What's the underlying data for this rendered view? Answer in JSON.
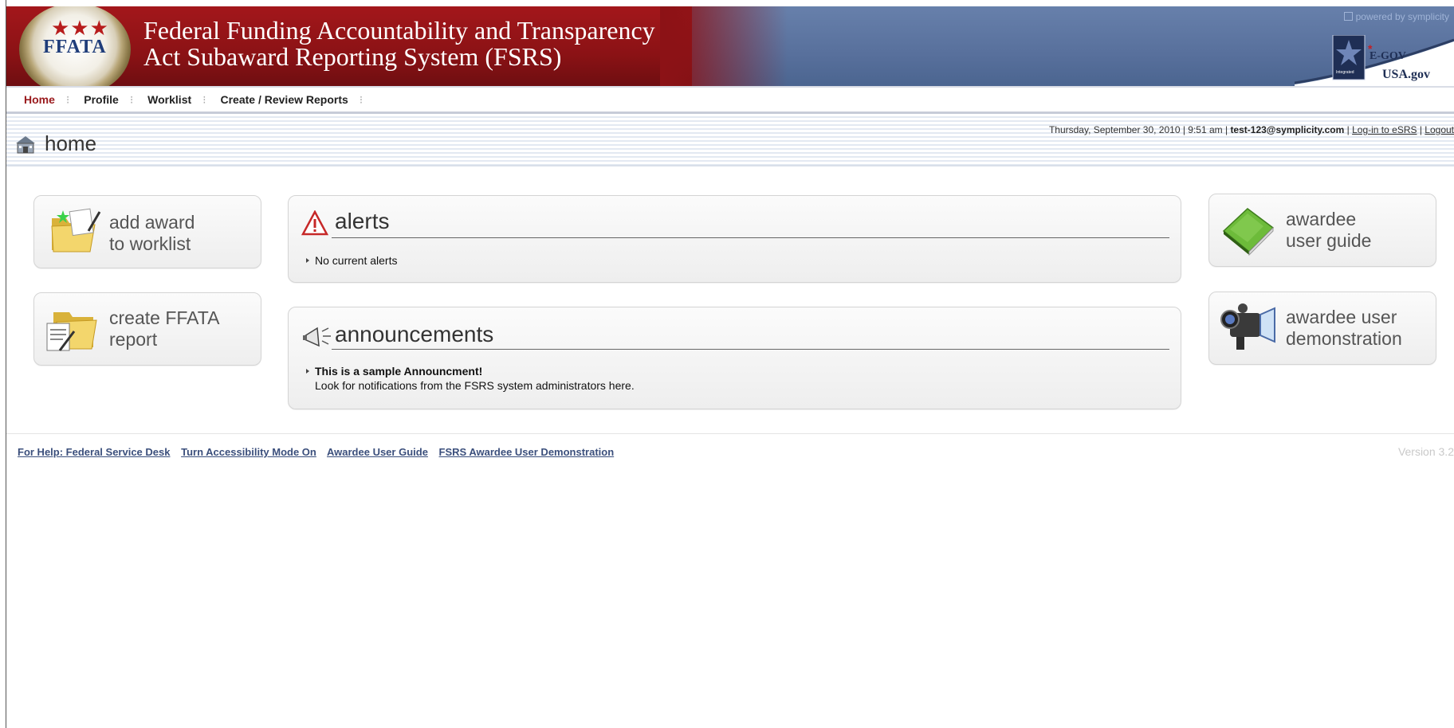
{
  "header": {
    "title_line1": "Federal Funding Accountability and Transparency",
    "title_line2": "Act Subaward Reporting System (FSRS)",
    "seal_text": "FFATA",
    "powered_by": "powered by symplicity",
    "egov_label": "E-GOV",
    "usagov_label": "USA.gov"
  },
  "nav": {
    "items": [
      "Home",
      "Profile",
      "Worklist",
      "Create / Review Reports"
    ],
    "active": "Home"
  },
  "subheader": {
    "page_title": "home",
    "datetime": "Thursday, September 30, 2010 | 9:51 am |",
    "user": "test-123@symplicity.com",
    "login_esrs": "Log-in to eSRS",
    "logout": "Logout"
  },
  "tiles": {
    "add_award_line1": "add award",
    "add_award_line2": "to worklist",
    "create_report_line1": "create FFATA",
    "create_report_line2": "report",
    "guide_line1": "awardee",
    "guide_line2": "user guide",
    "demo_line1": "awardee user",
    "demo_line2": "demonstration"
  },
  "alerts": {
    "title": "alerts",
    "message": "No current alerts"
  },
  "announcements": {
    "title": "announcements",
    "headline": "This is a sample Announcment!",
    "body": "Look for notifications from the FSRS system administrators here."
  },
  "footer": {
    "links": [
      "For Help: Federal Service Desk",
      "Turn Accessibility Mode On",
      "Awardee User Guide",
      "FSRS Awardee User Demonstration"
    ],
    "version": "Version 3.2"
  },
  "colors": {
    "header_red": "#8b1215",
    "header_blue": "#58709c",
    "nav_active": "#9a1a1d",
    "link": "#3b4f7c"
  }
}
